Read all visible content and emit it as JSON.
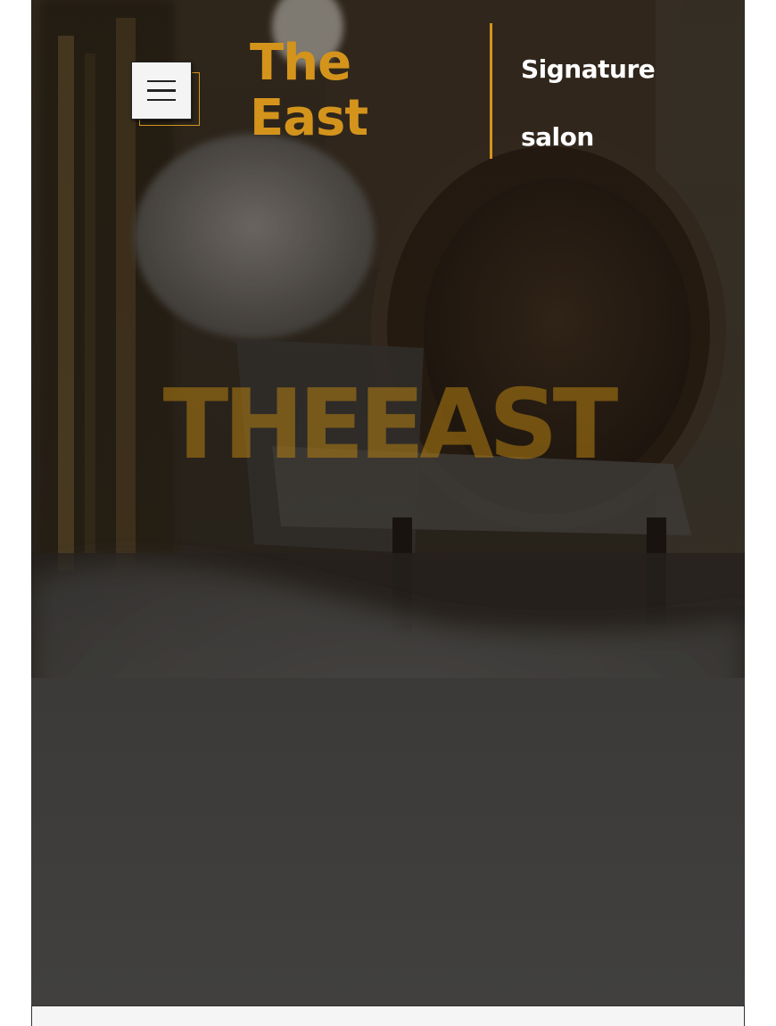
{
  "header": {
    "menu_icon": "hamburger-menu-icon",
    "logo_line1": "The",
    "logo_line2": "East",
    "tagline_line1": "Signature",
    "tagline_line2": "salon"
  },
  "hero": {
    "title": "THEEAST"
  },
  "colors": {
    "accent": "#d4941c",
    "title_overlay": "#b48012",
    "text_light": "#ffffff",
    "panel": "#f5f5f5"
  }
}
